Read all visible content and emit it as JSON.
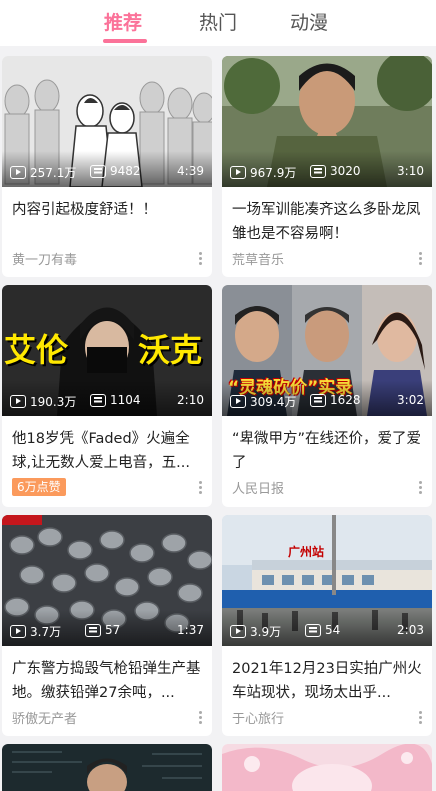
{
  "tabs": [
    {
      "label": "推荐",
      "active": true
    },
    {
      "label": "热门",
      "active": false
    },
    {
      "label": "动漫",
      "active": false
    }
  ],
  "cards": [
    {
      "plays": "257.1万",
      "danmaku": "9482",
      "duration": "4:39",
      "title": "内容引起极度舒适！！",
      "author": "黄一刀有毒"
    },
    {
      "plays": "967.9万",
      "danmaku": "3020",
      "duration": "3:10",
      "title": "一场军训能凑齐这么多卧龙凤雏也是不容易啊！",
      "author": "荒草音乐"
    },
    {
      "plays": "190.3万",
      "danmaku": "1104",
      "duration": "2:10",
      "title": "他18岁凭《Faded》火遍全球,让无数人爱上电音，五...",
      "badge": "6万点赞",
      "thumb_text": [
        "艾伦",
        "沃克"
      ]
    },
    {
      "plays": "309.4万",
      "danmaku": "1628",
      "duration": "3:02",
      "title": "“卑微甲方”在线还价，爱了爱了",
      "author": "人民日报",
      "thumb_text": [
        "“灵魂砍价”实录"
      ]
    },
    {
      "plays": "3.7万",
      "danmaku": "57",
      "duration": "1:37",
      "title": "广东警方捣毁气枪铅弹生产基地。缴获铅弹27余吨，...",
      "author": "骄傲无产者"
    },
    {
      "plays": "3.9万",
      "danmaku": "54",
      "duration": "2:03",
      "title": "2021年12月23日实拍广州火车站现状，现场太出乎...",
      "author": "于心旅行",
      "thumb_text": [
        "广州站"
      ]
    }
  ],
  "colors": {
    "accent": "#fb7299",
    "badge": "#fb9a5c"
  }
}
